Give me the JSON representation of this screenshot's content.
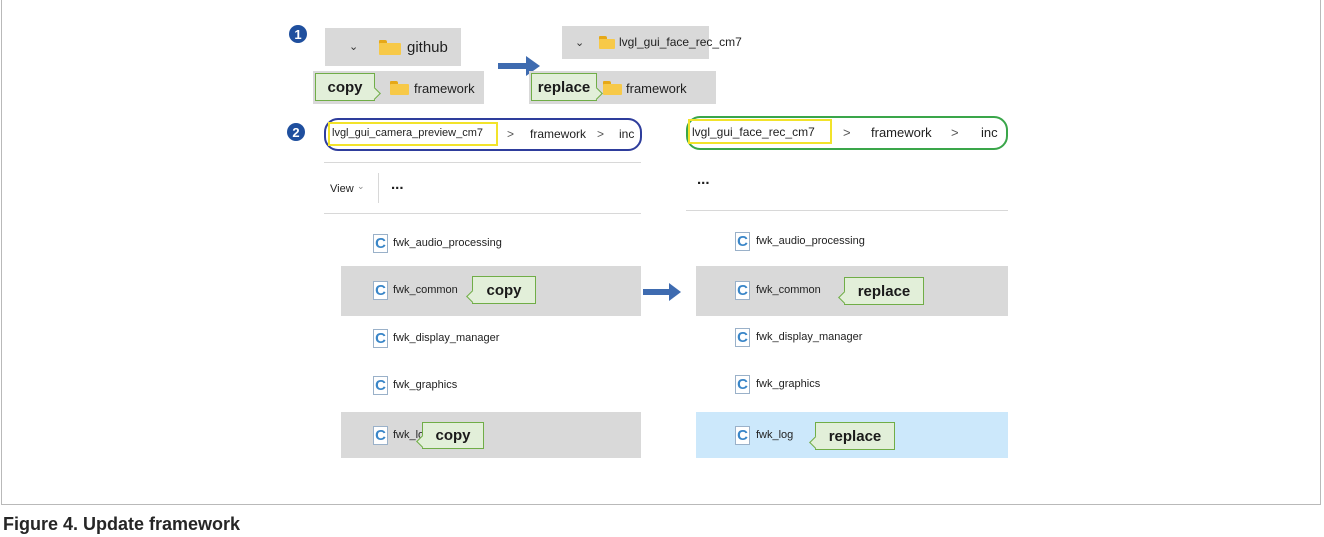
{
  "step1": {
    "badge": "1",
    "source_folder": "github",
    "target_folder": "lvgl_gui_face_rec_cm7",
    "sub_folder_left": "framework",
    "sub_folder_right": "framework",
    "copy_label": "copy",
    "replace_label": "replace"
  },
  "step2": {
    "badge": "2",
    "left_path": [
      "lvgl_gui_camera_preview_cm7",
      "framework",
      "inc"
    ],
    "right_path": [
      "lvgl_gui_face_rec_cm7",
      "framework",
      "inc"
    ],
    "separator": ">",
    "left_toolbar": {
      "view": "View",
      "more": "..."
    },
    "right_toolbar": {
      "more": "..."
    },
    "files": [
      "fwk_audio_processing",
      "fwk_common",
      "fwk_display_manager",
      "fwk_graphics",
      "fwk_log"
    ],
    "copy_label": "copy",
    "replace_label": "replace"
  },
  "caption": "Figure 4.  Update framework",
  "colors": {
    "badge": "#1f4f9e",
    "arrow": "#3e6bb0",
    "callout_fill": "#e2efd9",
    "callout_border": "#70ad47",
    "left_path_border": "#2e3d9c",
    "right_path_border": "#3aa64a",
    "highlight_yellow": "#f2e32a",
    "selected_gray": "#d9d9d9",
    "selected_blue": "#cce8fb"
  }
}
